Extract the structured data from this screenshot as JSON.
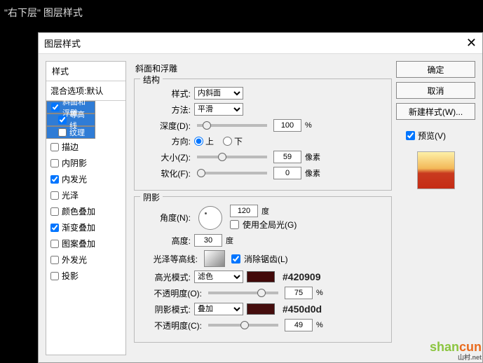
{
  "page_title": "\"右下层\" 图层样式",
  "dialog": {
    "title": "图层样式",
    "close": "✕"
  },
  "styles_panel": {
    "header": "样式",
    "blend": "混合选项:默认",
    "items": [
      {
        "label": "斜面和浮雕",
        "checked": true,
        "selected": true
      },
      {
        "label": "等高线",
        "checked": true,
        "selected": true,
        "sub": true
      },
      {
        "label": "纹理",
        "checked": false,
        "selected": true,
        "sub": true
      },
      {
        "label": "描边",
        "checked": false
      },
      {
        "label": "内阴影",
        "checked": false
      },
      {
        "label": "内发光",
        "checked": true
      },
      {
        "label": "光泽",
        "checked": false
      },
      {
        "label": "颜色叠加",
        "checked": false
      },
      {
        "label": "渐变叠加",
        "checked": true
      },
      {
        "label": "图案叠加",
        "checked": false
      },
      {
        "label": "外发光",
        "checked": false
      },
      {
        "label": "投影",
        "checked": false
      }
    ]
  },
  "bevel": {
    "title": "斜面和浮雕",
    "structure": "结构",
    "rows": {
      "style_lbl": "样式:",
      "style_val": "内斜面",
      "method_lbl": "方法:",
      "method_val": "平滑",
      "depth_lbl": "深度(D):",
      "depth_val": "100",
      "pct": "%",
      "dir_lbl": "方向:",
      "up": "上",
      "down": "下",
      "size_lbl": "大小(Z):",
      "size_val": "59",
      "px": "像素",
      "soften_lbl": "软化(F):",
      "soften_val": "0"
    }
  },
  "shading": {
    "title": "阴影",
    "angle_lbl": "角度(N):",
    "angle_val": "120",
    "deg": "度",
    "global_lbl": "使用全局光(G)",
    "alt_lbl": "高度:",
    "alt_val": "30",
    "contour_lbl": "光泽等高线:",
    "aa_lbl": "消除锯齿(L)",
    "hl_mode_lbl": "高光模式:",
    "hl_mode_val": "滤色",
    "hl_color": "#420909",
    "hl_hex": "#420909",
    "hl_op_lbl": "不透明度(O):",
    "hl_op_val": "75",
    "sh_mode_lbl": "阴影模式:",
    "sh_mode_val": "叠加",
    "sh_color": "#450d0d",
    "sh_hex": "#450d0d",
    "sh_op_lbl": "不透明度(C):",
    "sh_op_val": "49"
  },
  "buttons": {
    "ok": "确定",
    "cancel": "取消",
    "new_style": "新建样式(W)...",
    "preview": "预览(V)"
  },
  "watermark": {
    "t1": "shan",
    "t2": "cun",
    "sub": "山村.net"
  }
}
